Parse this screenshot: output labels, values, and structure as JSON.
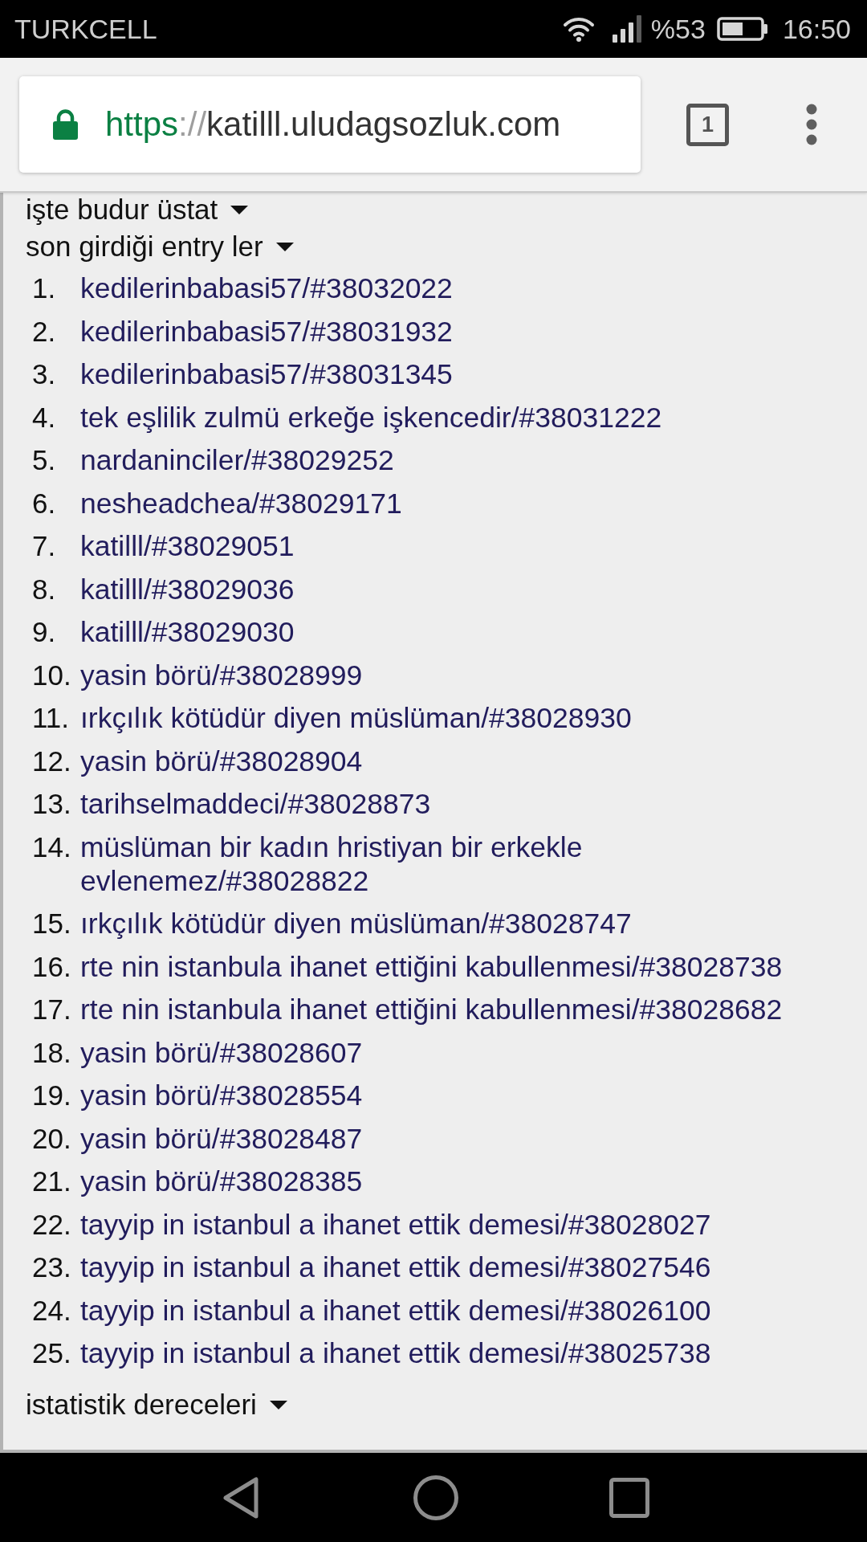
{
  "status_bar": {
    "carrier": "TURKCELL",
    "battery_text": "%53",
    "time": "16:50"
  },
  "browser_toolbar": {
    "address": {
      "scheme": "https",
      "separator": "://",
      "host": "katilll.uludagsozluk.com"
    },
    "tab_count": "1"
  },
  "sections": [
    {
      "title": "işte budur üstat"
    },
    {
      "title": "son girdiği entry ler",
      "entries": [
        {
          "number": "1.",
          "text": "kedilerinbabasi57/#38032022"
        },
        {
          "number": "2.",
          "text": "kedilerinbabasi57/#38031932"
        },
        {
          "number": "3.",
          "text": "kedilerinbabasi57/#38031345"
        },
        {
          "number": "4.",
          "text": "tek eşlilik zulmü erkeğe işkencedir/#38031222"
        },
        {
          "number": "5.",
          "text": "nardaninciler/#38029252"
        },
        {
          "number": "6.",
          "text": "nesheadchea/#38029171"
        },
        {
          "number": "7.",
          "text": "katilll/#38029051"
        },
        {
          "number": "8.",
          "text": "katilll/#38029036"
        },
        {
          "number": "9.",
          "text": "katilll/#38029030"
        },
        {
          "number": "10.",
          "text": "yasin börü/#38028999"
        },
        {
          "number": "11.",
          "text": "ırkçılık kötüdür diyen müslüman/#38028930"
        },
        {
          "number": "12.",
          "text": "yasin börü/#38028904"
        },
        {
          "number": "13.",
          "text": "tarihselmaddeci/#38028873"
        },
        {
          "number": "14.",
          "text": "müslüman bir kadın hristiyan bir erkekle evlenemez/#38028822"
        },
        {
          "number": "15.",
          "text": "ırkçılık kötüdür diyen müslüman/#38028747"
        },
        {
          "number": "16.",
          "text": "rte nin istanbula ihanet ettiğini kabullenmesi/#38028738"
        },
        {
          "number": "17.",
          "text": "rte nin istanbula ihanet ettiğini kabullenmesi/#38028682"
        },
        {
          "number": "18.",
          "text": "yasin börü/#38028607"
        },
        {
          "number": "19.",
          "text": "yasin börü/#38028554"
        },
        {
          "number": "20.",
          "text": "yasin börü/#38028487"
        },
        {
          "number": "21.",
          "text": "yasin börü/#38028385"
        },
        {
          "number": "22.",
          "text": "tayyip in istanbul a ihanet ettik demesi/#38028027"
        },
        {
          "number": "23.",
          "text": "tayyip in istanbul a ihanet ettik demesi/#38027546"
        },
        {
          "number": "24.",
          "text": "tayyip in istanbul a ihanet ettik demesi/#38026100"
        },
        {
          "number": "25.",
          "text": "tayyip in istanbul a ihanet ettik demesi/#38025738"
        }
      ]
    },
    {
      "title": "istatistik dereceleri"
    }
  ]
}
